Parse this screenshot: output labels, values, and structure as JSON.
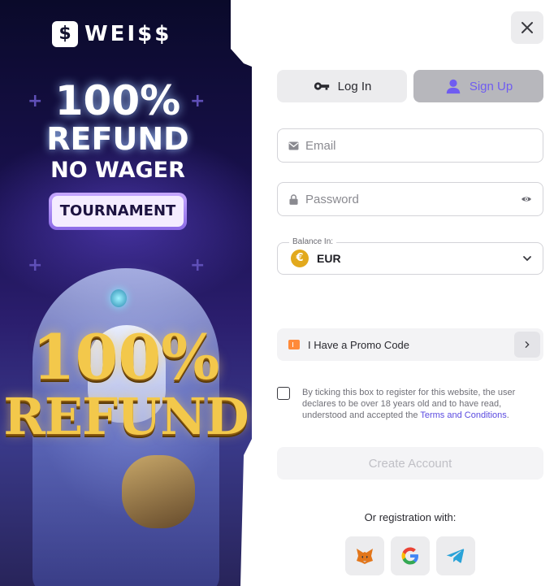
{
  "brand": {
    "logo_text": "WEI$$",
    "logo_mark": "$"
  },
  "promo": {
    "headline_line1": "100%",
    "headline_line2": "REFUND",
    "headline_line3": "NO WAGER",
    "badge": "TOURNAMENT",
    "art_line1": "100%",
    "art_line2": "REFUND"
  },
  "tabs": [
    {
      "label": "Log In",
      "icon": "key-icon",
      "active": false
    },
    {
      "label": "Sign Up",
      "icon": "user-icon",
      "active": true
    }
  ],
  "form": {
    "email": {
      "placeholder": "Email",
      "value": "",
      "icon": "mail-icon"
    },
    "password": {
      "placeholder": "Password",
      "value": "",
      "icon": "lock-icon",
      "toggle_icon": "eye-icon"
    },
    "balance": {
      "label": "Balance In:",
      "value": "EUR",
      "coin_symbol": "€",
      "coin_color": "#e2a91d"
    },
    "promo_code_label": "I Have a Promo Code",
    "terms_text": "By ticking this box to register for this website, the user declares to be over 18 years old and to have read, understood and accepted the ",
    "terms_link": "Terms and Conditions",
    "terms_end": ".",
    "terms_checked": false,
    "submit_label": "Create Account"
  },
  "social": {
    "heading": "Or registration with:",
    "providers": [
      "metamask-icon",
      "google-icon",
      "telegram-icon"
    ]
  },
  "colors": {
    "accent": "#6f5cf1",
    "link": "#5b4be0",
    "promo_icon": "#ff8a3a"
  }
}
